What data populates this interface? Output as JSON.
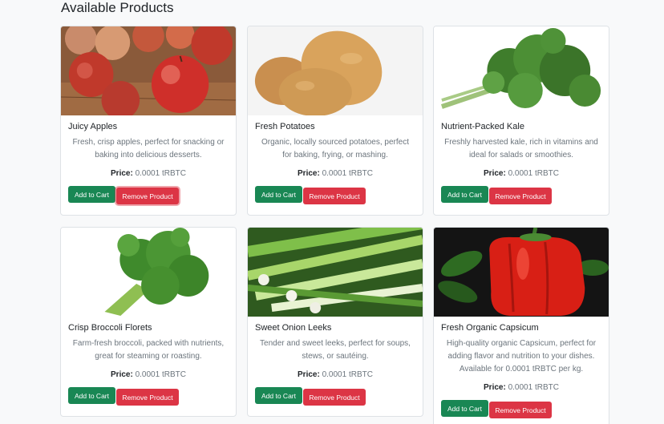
{
  "page": {
    "title": "Available Products"
  },
  "labels": {
    "price": "Price:",
    "add_to_cart": "Add to Cart",
    "remove_product": "Remove Product"
  },
  "products": [
    {
      "name": "Juicy Apples",
      "description": "Fresh, crisp apples, perfect for snacking or baking into delicious desserts.",
      "price": "0.0001 tRBTC",
      "image": "apples-image"
    },
    {
      "name": "Fresh Potatoes",
      "description": "Organic, locally sourced potatoes, perfect for baking, frying, or mashing.",
      "price": "0.0001 tRBTC",
      "image": "potatoes-image"
    },
    {
      "name": "Nutrient-Packed Kale",
      "description": "Freshly harvested kale, rich in vitamins and ideal for salads or smoothies.",
      "price": "0.0001 tRBTC",
      "image": "kale-image"
    },
    {
      "name": "Crisp Broccoli Florets",
      "description": "Farm-fresh broccoli, packed with nutrients, great for steaming or roasting.",
      "price": "0.0001 tRBTC",
      "image": "broccoli-image"
    },
    {
      "name": "Sweet Onion Leeks",
      "description": "Tender and sweet leeks, perfect for soups, stews, or sautéing.",
      "price": "0.0001 tRBTC",
      "image": "leeks-image"
    },
    {
      "name": "Fresh Organic Capsicum",
      "description": "High-quality organic Capsicum, perfect for adding flavor and nutrition to your dishes. Available for 0.0001 tRBTC per kg.",
      "price": "0.0001 tRBTC",
      "image": "capsicum-image"
    }
  ],
  "colors": {
    "add_button": "#198754",
    "remove_button": "#dc3545",
    "page_background": "#f8f9fa"
  }
}
